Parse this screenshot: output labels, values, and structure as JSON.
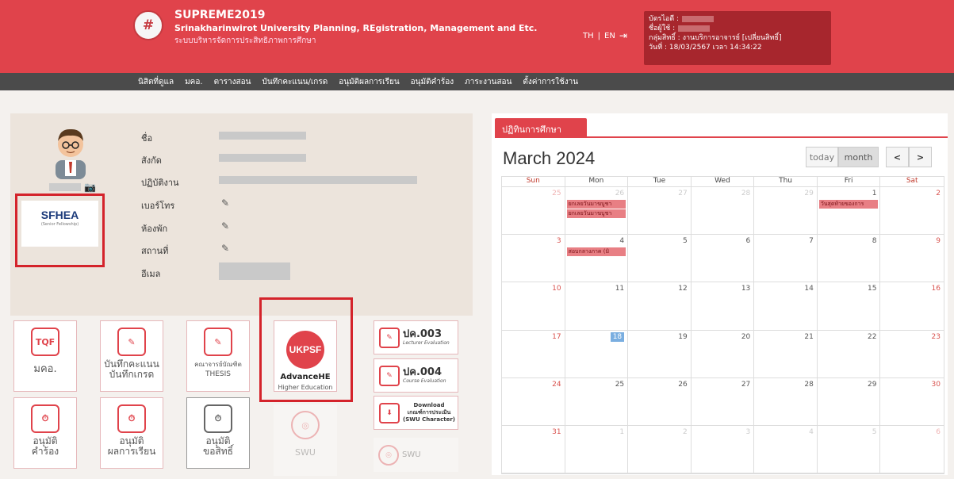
{
  "header": {
    "logo_text": "#",
    "title": "SUPREME2019",
    "subtitle": "Srinakharinwirot University Planning, REgistration, Management and Etc.",
    "thai_subtitle": "ระบบบริหารจัดการประสิทธิภาพการศึกษา",
    "lang_th": "TH",
    "lang_sep": "|",
    "lang_en": "EN",
    "logout_icon": "logout-icon",
    "user": {
      "profile_label": "บัตรไอดี :",
      "name_label": "ชื่อผู้ใช้ :",
      "group": "กลุ่มสิทธิ์ : งานบริการอาจารย์ [เปลี่ยนสิทธิ์]",
      "datetime": "วันที่ : 18/03/2567 เวลา 14:34:22"
    }
  },
  "nav": [
    "นิสิตที่ดูแล",
    "มคอ.",
    "ตารางสอน",
    "บันทึกคะแนน/เกรด",
    "อนุมัติผลการเรียน",
    "อนุมัติคำร้อง",
    "ภาระงานสอน",
    "ตั้งค่าการใช้งาน"
  ],
  "profile": {
    "camera_icon": "camera-icon",
    "badge_title": "SFHEA",
    "badge_sub": "(Senior Fellowship)",
    "fields": [
      {
        "label": "ชื่อ"
      },
      {
        "label": "สังกัด"
      },
      {
        "label": "ปฏิบัติงาน"
      },
      {
        "label": "เบอร์โทร",
        "edit": "✎"
      },
      {
        "label": "ห้องพัก",
        "edit": "✎"
      },
      {
        "label": "สถานที่",
        "edit": "✎"
      },
      {
        "label": "อีเมล"
      }
    ]
  },
  "tiles": {
    "tqf": {
      "icon": "TQF",
      "label": "มคอ."
    },
    "grades": {
      "icon": "✎",
      "label1": "บันทึกคะแนน",
      "label2": "บันทึกเกรด"
    },
    "thesis": {
      "icon": "✎",
      "label1": "คณาจารย์บัณฑิต",
      "label2": "THESIS"
    },
    "ukpsf": {
      "icon": "UKPSF",
      "label1": "AdvanceHE",
      "label2": "Higher Education"
    },
    "approve_request": {
      "icon": "⏱",
      "label1": "อนุมัติ",
      "label2": "คำร้อง"
    },
    "approve_results": {
      "icon": "⏱",
      "label1": "อนุมัติ",
      "label2": "ผลการเรียน"
    },
    "approve_rights": {
      "icon": "⏱",
      "label1": "อนุมัติ",
      "label2": "ขอสิทธิ์"
    },
    "swu1": {
      "icon": "◎",
      "label": "SWU"
    },
    "swu2": {
      "icon": "◎",
      "label": "SWU"
    },
    "pk003": {
      "icon": "✎",
      "title": "ปค.003",
      "sub": "Lecturer Evaluation"
    },
    "pk004": {
      "icon": "✎",
      "title": "ปค.004",
      "sub": "Course Evaluation"
    },
    "download": {
      "icon": "⬇",
      "line1": "Download",
      "line2": "เกณฑ์การประเมิน",
      "line3": "(SWU Character)"
    }
  },
  "calendar": {
    "tab": "ปฏิทินการศึกษา",
    "title": "March 2024",
    "today_btn": "today",
    "month_btn": "month",
    "prev": "<",
    "next": ">",
    "days": [
      "Sun",
      "Mon",
      "Tue",
      "Wed",
      "Thu",
      "Fri",
      "Sat"
    ],
    "cells": [
      {
        "d": "25",
        "o": 1
      },
      {
        "d": "26",
        "o": 1
      },
      {
        "d": "27",
        "o": 1
      },
      {
        "d": "28",
        "o": 1
      },
      {
        "d": "29",
        "o": 1
      },
      {
        "d": "1"
      },
      {
        "d": "2"
      },
      {
        "d": "3"
      },
      {
        "d": "4"
      },
      {
        "d": "5"
      },
      {
        "d": "6"
      },
      {
        "d": "7"
      },
      {
        "d": "8"
      },
      {
        "d": "9"
      },
      {
        "d": "10"
      },
      {
        "d": "11"
      },
      {
        "d": "12"
      },
      {
        "d": "13"
      },
      {
        "d": "14"
      },
      {
        "d": "15"
      },
      {
        "d": "16"
      },
      {
        "d": "17"
      },
      {
        "d": "18",
        "t": 1
      },
      {
        "d": "19"
      },
      {
        "d": "20"
      },
      {
        "d": "21"
      },
      {
        "d": "22"
      },
      {
        "d": "23"
      },
      {
        "d": "24"
      },
      {
        "d": "25"
      },
      {
        "d": "26"
      },
      {
        "d": "27"
      },
      {
        "d": "28"
      },
      {
        "d": "29"
      },
      {
        "d": "30"
      },
      {
        "d": "31"
      },
      {
        "d": "1",
        "o": 1
      },
      {
        "d": "2",
        "o": 1
      },
      {
        "d": "3",
        "o": 1
      },
      {
        "d": "4",
        "o": 1
      },
      {
        "d": "5",
        "o": 1
      },
      {
        "d": "6",
        "o": 1
      }
    ],
    "events": [
      {
        "cell": 1,
        "text": "ยกเลยวันมาฆบูชา"
      },
      {
        "cell": 1,
        "text": "ยกเลยวันมาฆบูชา"
      },
      {
        "cell": 5,
        "text": "วันสุดท้ายของการ"
      },
      {
        "cell": 8,
        "text": "สอบกลางภาค (มิ"
      }
    ]
  }
}
